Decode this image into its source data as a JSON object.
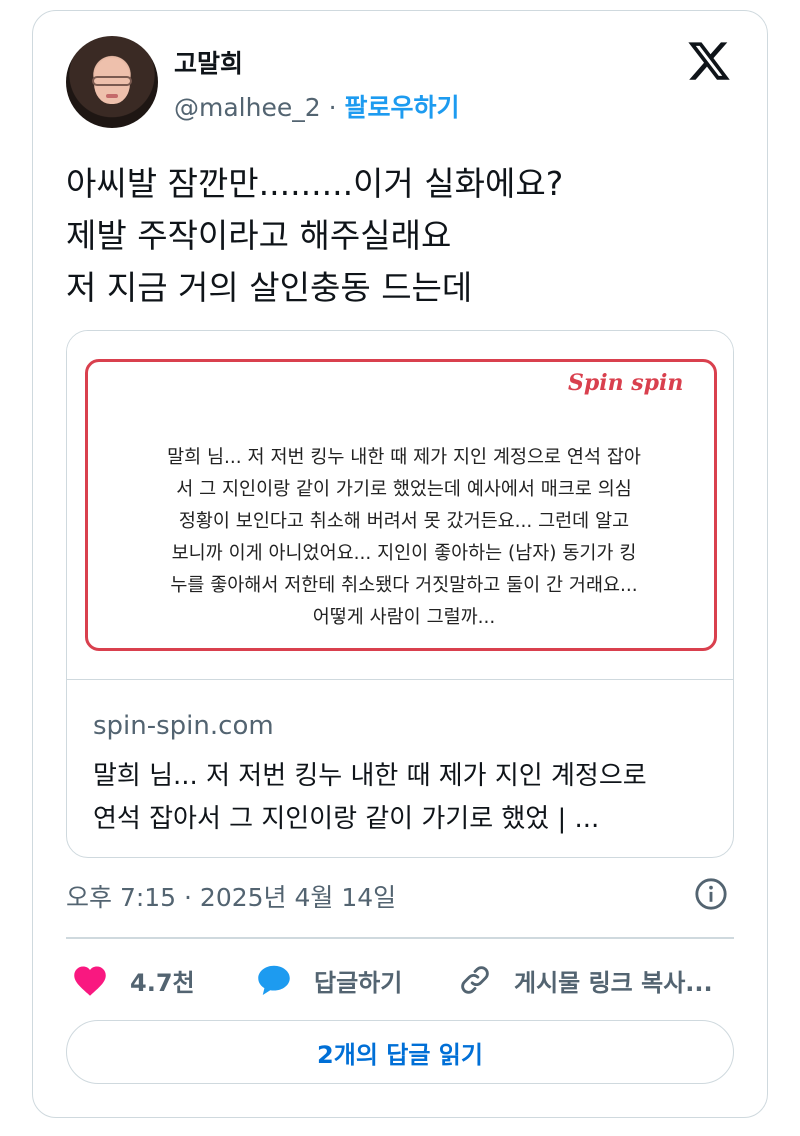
{
  "author": {
    "name": "고말희",
    "handle": "@malhee_2",
    "separator": "·",
    "follow_label": "팔로우하기"
  },
  "tweet": {
    "lines": [
      "아씨발 잠깐만.........이거 실화에요?",
      "제발 주작이라고 해주실래요",
      "저 지금 거의 살인충동 드는데"
    ]
  },
  "link_card": {
    "brand": "Spin spin",
    "image_text_lines": [
      "말희 님... 저 저번 킹누 내한 때 제가 지인 계정으로 연석 잡아",
      "서 그 지인이랑 같이 가기로 했었는데 예사에서 매크로 의심",
      "정황이 보인다고 취소해 버려서 못 갔거든요... 그런데 알고",
      "보니까 이게 아니었어요... 지인이 좋아하는 (남자) 동기가 킹",
      "누를 좋아해서 저한테 취소됐다 거짓말하고 둘이 간 거래요...",
      "어떻게 사람이 그럴까..."
    ],
    "domain": "spin-spin.com",
    "description_lines": [
      "말희 님... 저 저번 킹누 내한 때 제가 지인 계정으로",
      "연석 잡아서 그 지인이랑 같이 가기로 했었 | ..."
    ]
  },
  "timestamp": "오후 7:15 · 2025년 4월 14일",
  "actions": {
    "likes": "4.7천",
    "reply_label": "답글하기",
    "copy_link_label": "게시물 링크 복사..."
  },
  "read_replies_label": "2개의 답글 읽기",
  "colors": {
    "accent": "#1d9bf0",
    "like": "#f91880",
    "brand": "#d9404e",
    "muted": "#536471"
  }
}
